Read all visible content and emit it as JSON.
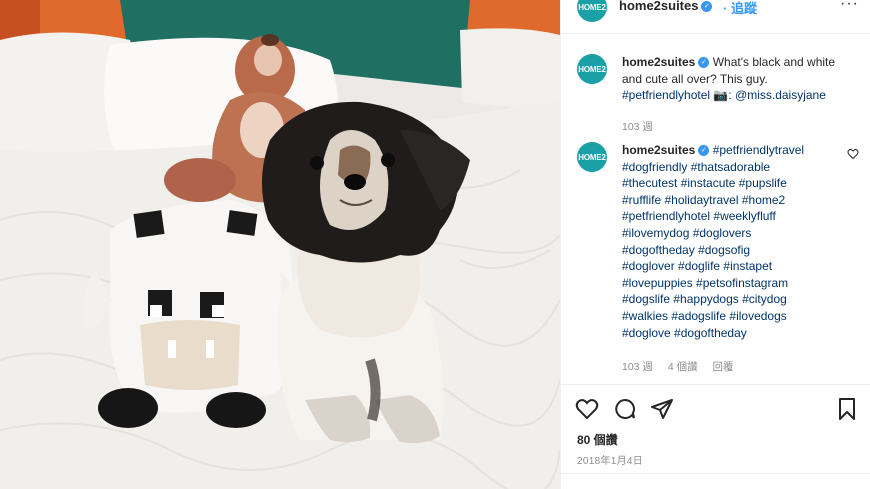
{
  "header": {
    "avatar_text": "HOME2",
    "username": "home2suites",
    "follow_label": "追蹤",
    "more_label": "···"
  },
  "caption": {
    "username": "home2suites",
    "text_before_tag": "What's black and white and cute all over? This guy.",
    "tag": "#petfriendlyhotel",
    "camera": "📷",
    "mention": ": @miss.daisyjane",
    "time": "103 週"
  },
  "comment": {
    "username": "home2suites",
    "line1": "#petfriendlytravel",
    "lines": [
      "#dogfriendly #thatsadorable",
      "#thecutest #instacute #pupslife",
      "#rufflife #holidaytravel #home2",
      "#petfriendlyhotel #weeklyfluff",
      "#ilovemydog #doglovers",
      "#dogoftheday #dogsofig",
      "#doglover #doglife #instapet",
      "#lovepuppies #petsofinstagram",
      "#dogslife #happydogs #citydog",
      "#walkies #adogslife #ilovedogs",
      "#doglove #dogoftheday"
    ],
    "time": "103 週",
    "likes": "4 個讚",
    "reply": "回覆"
  },
  "post": {
    "likes": "80 個讚",
    "date": "2018年1月4日"
  },
  "colors": {
    "link": "#003569",
    "follow": "#3897f0",
    "avatar": "#1aa0a7",
    "muted": "#8e8e8e"
  },
  "icons": [
    "verified-badge-icon",
    "more-icon",
    "heart-icon",
    "comment-icon",
    "share-icon",
    "bookmark-icon"
  ]
}
